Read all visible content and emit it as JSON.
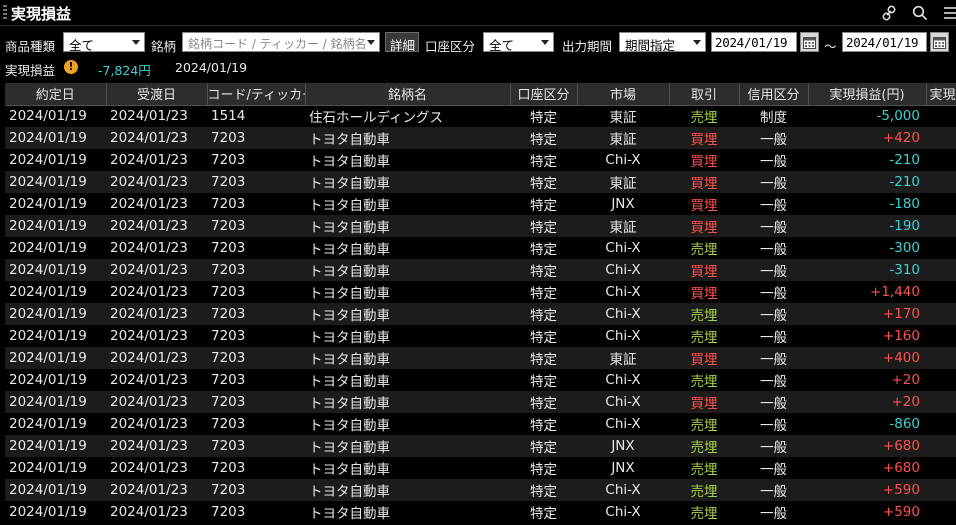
{
  "window": {
    "title": "実現損益"
  },
  "icons": {
    "link": "link-icon",
    "search": "search-icon",
    "menu": "menu-icon",
    "calendar": "calendar-icon",
    "warning": "warning-icon"
  },
  "filters": {
    "product_type_label": "商品種類",
    "product_type_value": "全て",
    "symbol_label": "銘柄",
    "symbol_placeholder": "銘柄コード / ティッカー / 銘柄名",
    "detail_button": "詳細",
    "account_label": "口座区分",
    "account_value": "全て",
    "period_label": "出力期間",
    "period_value": "期間指定",
    "date_from": "2024/01/19",
    "range_sep": "～",
    "date_to": "2024/01/19"
  },
  "summary": {
    "label": "実現損益",
    "warning_mark": "!",
    "amount": "-7,824円",
    "date": "2024/01/19"
  },
  "colors": {
    "sell": "#a8d24a",
    "buy": "#ff5050",
    "positive": "#ff5050",
    "negative": "#3cd2d2",
    "warning": "#f0a020"
  },
  "table": {
    "headers": [
      "約定日",
      "受渡日",
      "コード/ティッカー",
      "銘柄名",
      "口座区分",
      "市場",
      "取引",
      "信用区分",
      "実現損益(円)",
      "実現損"
    ],
    "rows": [
      [
        "2024/01/19",
        "2024/01/23",
        "1514",
        "住石ホールディングス",
        "特定",
        "東証",
        "売埋",
        "制度",
        "-5,000"
      ],
      [
        "2024/01/19",
        "2024/01/23",
        "7203",
        "トヨタ自動車",
        "特定",
        "東証",
        "買埋",
        "一般",
        "+420"
      ],
      [
        "2024/01/19",
        "2024/01/23",
        "7203",
        "トヨタ自動車",
        "特定",
        "Chi-X",
        "買埋",
        "一般",
        "-210"
      ],
      [
        "2024/01/19",
        "2024/01/23",
        "7203",
        "トヨタ自動車",
        "特定",
        "東証",
        "買埋",
        "一般",
        "-210"
      ],
      [
        "2024/01/19",
        "2024/01/23",
        "7203",
        "トヨタ自動車",
        "特定",
        "JNX",
        "買埋",
        "一般",
        "-180"
      ],
      [
        "2024/01/19",
        "2024/01/23",
        "7203",
        "トヨタ自動車",
        "特定",
        "東証",
        "買埋",
        "一般",
        "-190"
      ],
      [
        "2024/01/19",
        "2024/01/23",
        "7203",
        "トヨタ自動車",
        "特定",
        "Chi-X",
        "売埋",
        "一般",
        "-300"
      ],
      [
        "2024/01/19",
        "2024/01/23",
        "7203",
        "トヨタ自動車",
        "特定",
        "Chi-X",
        "買埋",
        "一般",
        "-310"
      ],
      [
        "2024/01/19",
        "2024/01/23",
        "7203",
        "トヨタ自動車",
        "特定",
        "Chi-X",
        "買埋",
        "一般",
        "+1,440"
      ],
      [
        "2024/01/19",
        "2024/01/23",
        "7203",
        "トヨタ自動車",
        "特定",
        "Chi-X",
        "売埋",
        "一般",
        "+170"
      ],
      [
        "2024/01/19",
        "2024/01/23",
        "7203",
        "トヨタ自動車",
        "特定",
        "Chi-X",
        "売埋",
        "一般",
        "+160"
      ],
      [
        "2024/01/19",
        "2024/01/23",
        "7203",
        "トヨタ自動車",
        "特定",
        "東証",
        "買埋",
        "一般",
        "+400"
      ],
      [
        "2024/01/19",
        "2024/01/23",
        "7203",
        "トヨタ自動車",
        "特定",
        "Chi-X",
        "売埋",
        "一般",
        "+20"
      ],
      [
        "2024/01/19",
        "2024/01/23",
        "7203",
        "トヨタ自動車",
        "特定",
        "Chi-X",
        "買埋",
        "一般",
        "+20"
      ],
      [
        "2024/01/19",
        "2024/01/23",
        "7203",
        "トヨタ自動車",
        "特定",
        "Chi-X",
        "売埋",
        "一般",
        "-860"
      ],
      [
        "2024/01/19",
        "2024/01/23",
        "7203",
        "トヨタ自動車",
        "特定",
        "JNX",
        "売埋",
        "一般",
        "+680"
      ],
      [
        "2024/01/19",
        "2024/01/23",
        "7203",
        "トヨタ自動車",
        "特定",
        "JNX",
        "売埋",
        "一般",
        "+680"
      ],
      [
        "2024/01/19",
        "2024/01/23",
        "7203",
        "トヨタ自動車",
        "特定",
        "Chi-X",
        "売埋",
        "一般",
        "+590"
      ],
      [
        "2024/01/19",
        "2024/01/23",
        "7203",
        "トヨタ自動車",
        "特定",
        "Chi-X",
        "売埋",
        "一般",
        "+590"
      ]
    ]
  }
}
